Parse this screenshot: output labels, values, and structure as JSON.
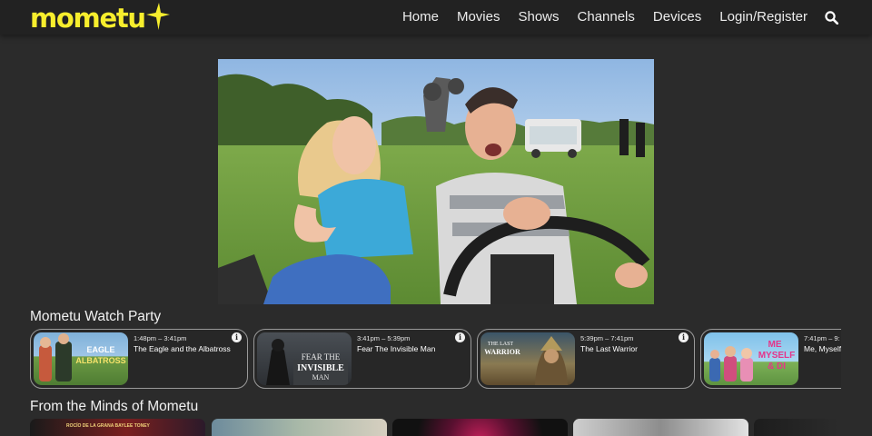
{
  "header": {
    "logo_text": "mometu",
    "nav": [
      "Home",
      "Movies",
      "Shows",
      "Channels",
      "Devices",
      "Login/Register"
    ],
    "search_icon": "search-icon"
  },
  "colors": {
    "brand_yellow": "#f7ee2d",
    "background": "#2b2b2b",
    "header_background": "#222222",
    "card_border": "#9a9a9a"
  },
  "watch_party": {
    "title": "Mometu Watch Party",
    "items": [
      {
        "time": "1:48pm – 3:41pm",
        "name": "The Eagle and the Albatross",
        "thumb_text": "EAGLE AND THE ALBATROSS"
      },
      {
        "time": "3:41pm – 5:39pm",
        "name": "Fear The Invisible Man",
        "thumb_text": "FEAR THE INVISIBLE MAN"
      },
      {
        "time": "5:39pm – 7:41pm",
        "name": "The Last Warrior",
        "thumb_text": "THE LAST WARRIOR"
      },
      {
        "time": "7:41pm – 9:",
        "name": "Me, Myself",
        "thumb_text": "ME MYSELF & DI"
      }
    ]
  },
  "from_minds": {
    "title": "From the Minds of Mometu",
    "thumb_text": "ROCÍO DE LA GRANA  BAYLEE TONEY"
  }
}
